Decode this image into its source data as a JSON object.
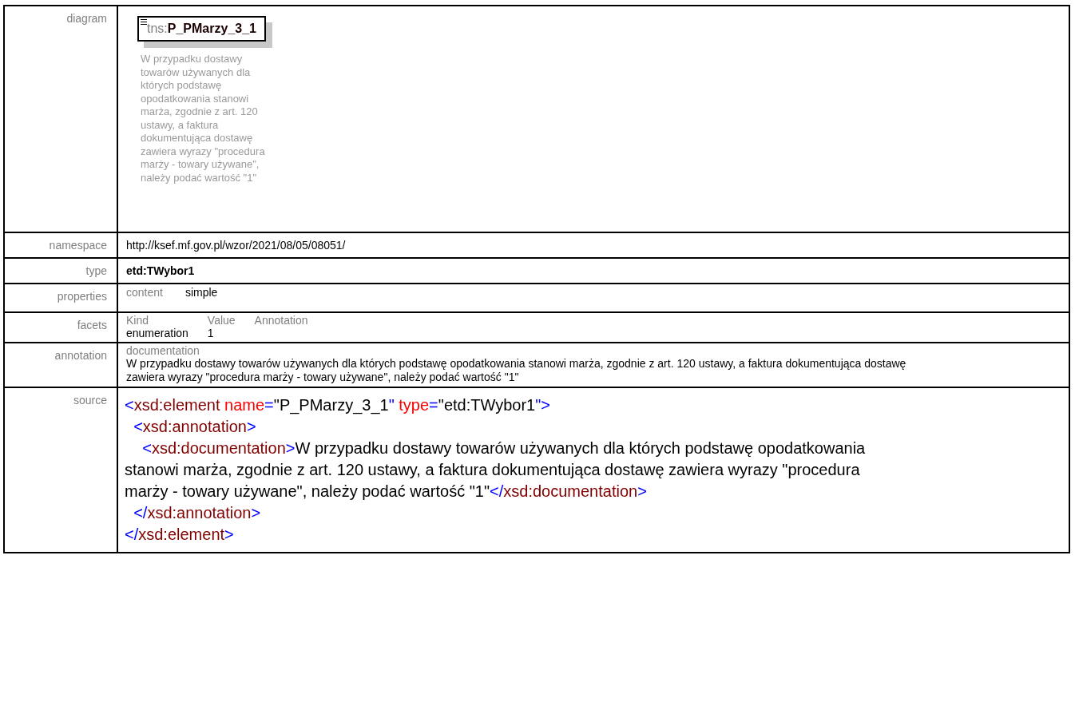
{
  "rows": [
    {
      "kind": "diagram",
      "label": "diagram",
      "element": {
        "prefix": "tns:",
        "name": "P_PMarzy_3_1"
      },
      "annotation": "W przypadku dostawy towarów używanych dla których podstawę opodatkowania stanowi marża, zgodnie z art. 120 ustawy, a faktura dokumentująca dostawę zawiera wyrazy \"procedura marży - towary używane\", należy podać wartość \"1\""
    },
    {
      "kind": "text",
      "label": "namespace",
      "value": "http://ksef.mf.gov.pl/wzor/2021/08/05/08051/"
    },
    {
      "kind": "bold",
      "label": "type",
      "value": "etd:TWybor1"
    },
    {
      "kind": "properties",
      "label": "properties",
      "items": [
        {
          "name": "content",
          "value": "simple"
        }
      ]
    },
    {
      "kind": "facets",
      "label": "facets",
      "columns": [
        "Kind",
        "Value",
        "Annotation"
      ],
      "rows": [
        {
          "kind": "enumeration",
          "value": "1"
        }
      ]
    },
    {
      "kind": "annotation",
      "label": "annotation",
      "heading": "documentation",
      "text": "W przypadku dostawy towarów używanych dla których podstawę opodatkowania stanowi marża, zgodnie z art. 120 ustawy, a faktura dokumentująca dostawę zawiera wyrazy \"procedura marży - towary używane\", należy podać wartość \"1\""
    },
    {
      "kind": "source",
      "label": "source",
      "lines": [
        [
          {
            "kind": "punct",
            "s": "<"
          },
          {
            "kind": "tag",
            "s": "xsd:element "
          },
          {
            "kind": "attr",
            "s": "name"
          },
          {
            "kind": "punct",
            "s": "="
          },
          {
            "kind": "text",
            "s": "\"P_PMarzy_3_1"
          },
          {
            "kind": "punct",
            "s": "\" "
          },
          {
            "kind": "attr",
            "s": "type"
          },
          {
            "kind": "punct",
            "s": "="
          },
          {
            "kind": "text",
            "s": "\"etd:TWybor1"
          },
          {
            "kind": "punct",
            "s": "\">"
          }
        ],
        [
          {
            "kind": "punct",
            "s": "  <"
          },
          {
            "kind": "tag",
            "s": "xsd:annotation"
          },
          {
            "kind": "punct",
            "s": ">"
          }
        ],
        [
          {
            "kind": "punct",
            "s": "    <"
          },
          {
            "kind": "tag",
            "s": "xsd:documentation"
          },
          {
            "kind": "punct",
            "s": ">"
          },
          {
            "kind": "text",
            "s": "W przypadku dostawy towarów używanych dla których podstawę opodatkowania stanowi marża, zgodnie z art. 120 ustawy, a faktura dokumentująca dostawę zawiera wyrazy \"procedura marży - towary używane\", należy podać wartość \"1\""
          },
          {
            "kind": "punct",
            "s": "</"
          },
          {
            "kind": "tag",
            "s": "xsd:documentation"
          },
          {
            "kind": "punct",
            "s": ">"
          }
        ],
        [
          {
            "kind": "punct",
            "s": "  </"
          },
          {
            "kind": "tag",
            "s": "xsd:annotation"
          },
          {
            "kind": "punct",
            "s": ">"
          }
        ],
        [
          {
            "kind": "punct",
            "s": "</"
          },
          {
            "kind": "tag",
            "s": "xsd:element"
          },
          {
            "kind": "punct",
            "s": ">"
          }
        ]
      ]
    }
  ]
}
